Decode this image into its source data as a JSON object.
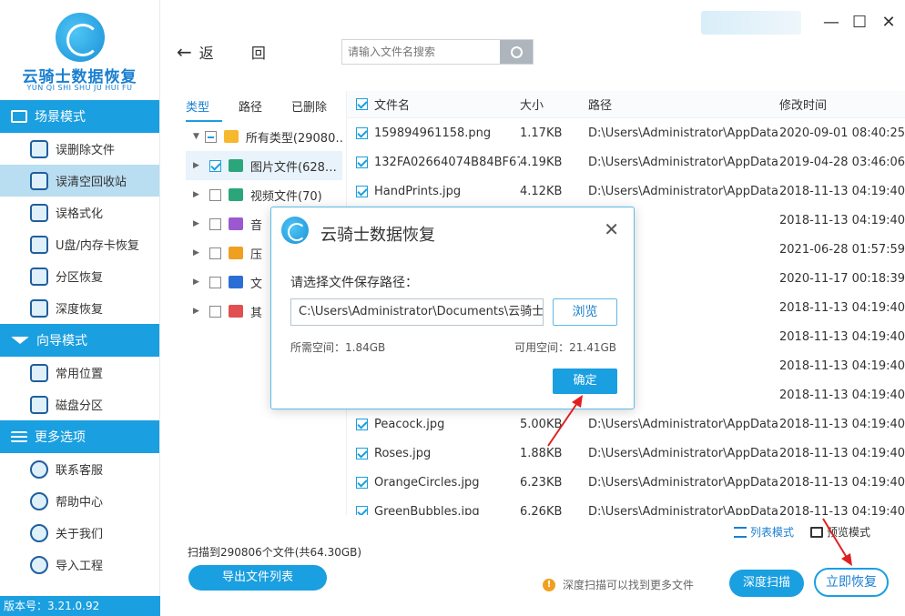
{
  "colors": {
    "accent": "#1a9fe0",
    "accent_text": "#1a7fd0",
    "annotation": "#e02020",
    "selected_nav": "#b9ddf1"
  },
  "app": {
    "brand": "云骑士数据恢复",
    "brand_pinyin": "YUN QI SHI SHU JU HUI FU",
    "version": "版本号：3.21.0.92"
  },
  "sidebar": {
    "sections": [
      {
        "title": "场景模式",
        "icon": "screen-icon",
        "items": [
          {
            "label": "误删除文件",
            "icon": "file-search-icon"
          },
          {
            "label": "误清空回收站",
            "icon": "recycle-bin-icon",
            "active": true
          },
          {
            "label": "误格式化",
            "icon": "format-icon"
          },
          {
            "label": "U盘/内存卡恢复",
            "icon": "usb-icon"
          },
          {
            "label": "分区恢复",
            "icon": "partition-icon"
          },
          {
            "label": "深度恢复",
            "icon": "deep-recover-icon"
          }
        ]
      },
      {
        "title": "向导模式",
        "icon": "signpost-icon",
        "items": [
          {
            "label": "常用位置",
            "icon": "windows-icon"
          },
          {
            "label": "磁盘分区",
            "icon": "disk-icon"
          }
        ]
      },
      {
        "title": "更多选项",
        "icon": "menu-icon",
        "items": [
          {
            "label": "联系客服",
            "icon": "phone-icon"
          },
          {
            "label": "帮助中心",
            "icon": "help-icon"
          },
          {
            "label": "关于我们",
            "icon": "info-icon"
          },
          {
            "label": "导入工程",
            "icon": "import-icon"
          }
        ]
      }
    ]
  },
  "toolbar": {
    "back_label": "返 回",
    "search_placeholder": "请输入文件名搜索"
  },
  "tree": {
    "tabs": [
      "类型",
      "路径",
      "已删除"
    ],
    "rows": [
      {
        "label": "所有类型(29080…",
        "caret": "▼",
        "check": "partial",
        "icon_color": "#f5b82e"
      },
      {
        "label": "图片文件(628…",
        "caret": "▶",
        "check": "checked",
        "icon_color": "#2aa67a",
        "selected": true
      },
      {
        "label": "视频文件(70)",
        "caret": "▶",
        "check": "none",
        "icon_color": "#2aa67a"
      },
      {
        "label": "音",
        "caret": "▶",
        "check": "none",
        "icon_color": "#9b59d0"
      },
      {
        "label": "压",
        "caret": "▶",
        "check": "none",
        "icon_color": "#f0a020"
      },
      {
        "label": "文",
        "caret": "▶",
        "check": "none",
        "icon_color": "#2b6fd6"
      },
      {
        "label": "其",
        "caret": "▶",
        "check": "none",
        "icon_color": "#e05050"
      }
    ]
  },
  "table": {
    "headers": {
      "name": "文件名",
      "size": "大小",
      "path": "路径",
      "date": "修改时间"
    },
    "rows": [
      {
        "name": "159894961158.png",
        "size": "1.17KB",
        "path": "D:\\Users\\Administrator\\AppData...",
        "date": "2020-09-01 08:40:25"
      },
      {
        "name": "132FA02664074B84BF67...",
        "size": "4.19KB",
        "path": "D:\\Users\\Administrator\\AppData...",
        "date": "2019-04-28 03:46:06"
      },
      {
        "name": "HandPrints.jpg",
        "size": "4.12KB",
        "path": "D:\\Users\\Administrator\\AppData...",
        "date": "2018-11-13 04:19:40"
      },
      {
        "name": "",
        "size": "",
        "path": "",
        "date": "2018-11-13 04:19:40"
      },
      {
        "name": "",
        "size": "",
        "path": "",
        "date": "2021-06-28 01:57:59"
      },
      {
        "name": "",
        "size": "",
        "path": "",
        "date": "2020-11-17 00:18:39"
      },
      {
        "name": "",
        "size": "",
        "path": "",
        "date": "2018-11-13 04:19:40"
      },
      {
        "name": "",
        "size": "",
        "path": "",
        "date": "2018-11-13 04:19:40"
      },
      {
        "name": "",
        "size": "",
        "path": "",
        "date": "2018-11-13 04:19:40"
      },
      {
        "name": "",
        "size": "",
        "path": "",
        "date": "2018-11-13 04:19:40"
      },
      {
        "name": "Peacock.jpg",
        "size": "5.00KB",
        "path": "D:\\Users\\Administrator\\AppData...",
        "date": "2018-11-13 04:19:40"
      },
      {
        "name": "Roses.jpg",
        "size": "1.88KB",
        "path": "D:\\Users\\Administrator\\AppData...",
        "date": "2018-11-13 04:19:40"
      },
      {
        "name": "OrangeCircles.jpg",
        "size": "6.23KB",
        "path": "D:\\Users\\Administrator\\AppData...",
        "date": "2018-11-13 04:19:40"
      },
      {
        "name": "GreenBubbles.jpg",
        "size": "6.26KB",
        "path": "D:\\Users\\Administrator\\AppData...",
        "date": "2018-11-13 04:19:40"
      }
    ]
  },
  "bottom": {
    "scan_summary": "扫描到290806个文件(共64.30GB)",
    "export_label": "导出文件列表",
    "list_mode": "列表模式",
    "preview_mode": "预览模式",
    "deep_hint": "深度扫描可以找到更多文件",
    "deep_scan_label": "深度扫描",
    "recover_label": "立即恢复"
  },
  "dialog": {
    "title": "云骑士数据恢复",
    "prompt": "请选择文件保存路径：",
    "path_value": "C:\\Users\\Administrator\\Documents\\云骑士\\",
    "browse_label": "浏览",
    "required_space": "所需空间：1.84GB",
    "available_space": "可用空间：21.41GB",
    "ok_label": "确定"
  }
}
